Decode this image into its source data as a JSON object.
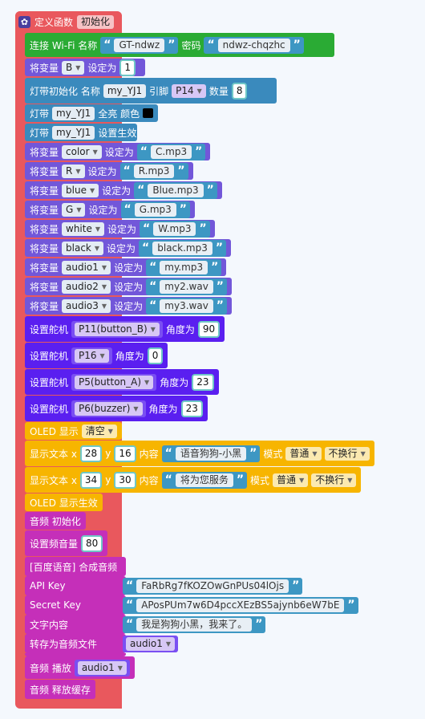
{
  "func": {
    "label": "定义函数",
    "name": "初始化"
  },
  "wifi": {
    "label": "连接 Wi-Fi 名称",
    "ssid": "GT-ndwz",
    "pwd_label": "密码",
    "pwd": "ndwz-chqzhc"
  },
  "setB": {
    "prefix": "将变量",
    "var": "B",
    "suffix": "设定为",
    "value": "1"
  },
  "strip": {
    "label": "灯带初始化 名称",
    "name": "my_YJ1",
    "pin_label": "引脚",
    "pin": "P14",
    "count_label": "数量",
    "count": "8"
  },
  "fill": {
    "prefix": "灯带",
    "name": "my_YJ1",
    "suffix": "全亮 颜色",
    "color": "#000000"
  },
  "show": {
    "prefix": "灯带",
    "name": "my_YJ1",
    "suffix": "设置生效"
  },
  "vars": [
    {
      "prefix": "将变量",
      "var": "color",
      "suffix": "设定为",
      "value": "C.mp3"
    },
    {
      "prefix": "将变量",
      "var": "R",
      "suffix": "设定为",
      "value": "R.mp3"
    },
    {
      "prefix": "将变量",
      "var": "blue",
      "suffix": "设定为",
      "value": "Blue.mp3"
    },
    {
      "prefix": "将变量",
      "var": "G",
      "suffix": "设定为",
      "value": "G.mp3"
    },
    {
      "prefix": "将变量",
      "var": "white",
      "suffix": "设定为",
      "value": "W.mp3"
    },
    {
      "prefix": "将变量",
      "var": "black",
      "suffix": "设定为",
      "value": "black.mp3"
    },
    {
      "prefix": "将变量",
      "var": "audio1",
      "suffix": "设定为",
      "value": "my.mp3"
    },
    {
      "prefix": "将变量",
      "var": "audio2",
      "suffix": "设定为",
      "value": "my2.wav"
    },
    {
      "prefix": "将变量",
      "var": "audio3",
      "suffix": "设定为",
      "value": "my3.wav"
    }
  ],
  "servos": [
    {
      "label": "设置舵机",
      "pin": "P11(button_B)",
      "angle_label": "角度为",
      "angle": "90"
    },
    {
      "label": "设置舵机",
      "pin": "P16",
      "angle_label": "角度为",
      "angle": "0"
    },
    {
      "label": "设置舵机",
      "pin": "P5(button_A)",
      "angle_label": "角度为",
      "angle": "23"
    },
    {
      "label": "设置舵机",
      "pin": "P6(buzzer)",
      "angle_label": "角度为",
      "angle": "23"
    }
  ],
  "oled": {
    "label": "OLED 显示",
    "clear": "清空"
  },
  "texts": [
    {
      "label": "显示文本 x",
      "x": "28",
      "y_label": "y",
      "y": "16",
      "content_label": "内容",
      "content": "语音狗狗-小黑",
      "mode_label": "模式",
      "mode": "普通",
      "wrap": "不换行"
    },
    {
      "label": "显示文本 x",
      "x": "34",
      "y_label": "y",
      "y": "30",
      "content_label": "内容",
      "content": "将为您服务",
      "mode_label": "模式",
      "mode": "普通",
      "wrap": "不换行"
    }
  ],
  "oled_show": "OLED 显示生效",
  "audio_init": "音频 初始化",
  "volume": {
    "label": "设置频音量",
    "value": "80"
  },
  "baidu": {
    "title": "[百度语音] 合成音频",
    "api_label": "API Key",
    "api": "FaRbRg7fKOZOwGnPUs04lOjs",
    "secret_label": "Secret Key",
    "secret": "APosPUm7w6D4pccXEzBS5ajynb6eW7bE",
    "text_label": "文字内容",
    "text": "我是狗狗小黑，我来了。",
    "file_label": "转存为音频文件",
    "file": "audio1"
  },
  "play": {
    "label": "音频 播放",
    "file": "audio1"
  },
  "release": "音频 释放缓存"
}
